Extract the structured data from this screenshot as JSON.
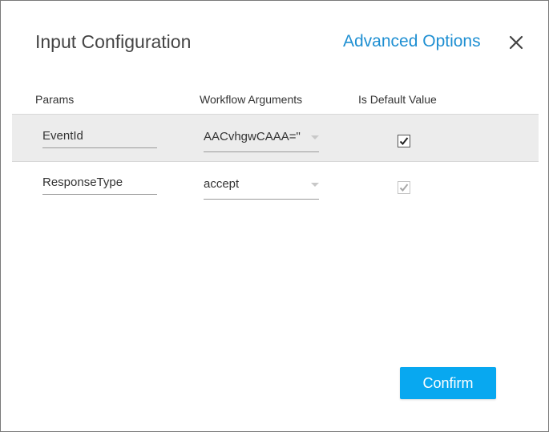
{
  "dialog": {
    "title": "Input Configuration",
    "advanced_link": "Advanced Options",
    "close_icon": "close-icon"
  },
  "columns": {
    "params": "Params",
    "workflow_arguments": "Workflow Arguments",
    "is_default_value": "Is Default Value"
  },
  "rows": [
    {
      "param": "EventId",
      "argument": "AACvhgwCAAA=\"",
      "is_default": true,
      "checkbox_enabled": true
    },
    {
      "param": "ResponseType",
      "argument": "accept",
      "is_default": true,
      "checkbox_enabled": false
    }
  ],
  "actions": {
    "confirm_label": "Confirm"
  },
  "colors": {
    "accent": "#08a8f0",
    "link": "#1e8fd2",
    "row_highlight": "#ececec"
  }
}
